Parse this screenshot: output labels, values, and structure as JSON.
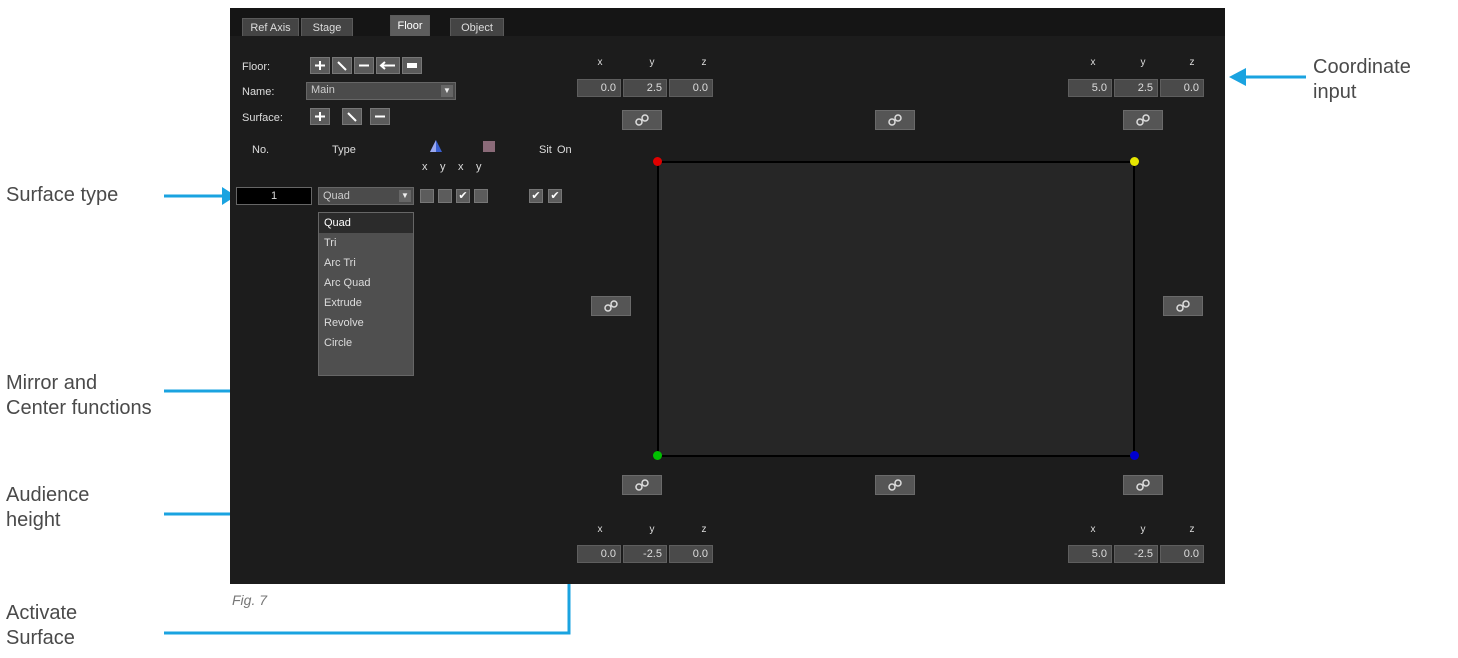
{
  "tabs": [
    "Ref Axis",
    "Stage",
    "Floor",
    "Object"
  ],
  "labels": {
    "floor": "Floor:",
    "name": "Name:",
    "surface": "Surface:"
  },
  "name_value": "Main",
  "headers": {
    "no": "No.",
    "type": "Type",
    "sit": "Sit",
    "on": "On",
    "x1": "x",
    "y1": "y",
    "x2": "x",
    "y2": "y"
  },
  "surface_row": {
    "number": "1",
    "type": "Quad",
    "checks": [
      false,
      false,
      true,
      false,
      true,
      true
    ]
  },
  "type_options": [
    "Quad",
    "Tri",
    "Arc Tri",
    "Arc Quad",
    "Extrude",
    "Revolve",
    "Circle"
  ],
  "coord_headers": [
    "x",
    "y",
    "z"
  ],
  "coords": {
    "top_left": [
      "0.0",
      "2.5",
      "0.0"
    ],
    "top_right": [
      "5.0",
      "2.5",
      "0.0"
    ],
    "bottom_left": [
      "0.0",
      "-2.5",
      "0.0"
    ],
    "bottom_right": [
      "5.0",
      "-2.5",
      "0.0"
    ]
  },
  "corner_colors": {
    "top_left": "#e00000",
    "top_right": "#e6e600",
    "bottom_left": "#00c000",
    "bottom_right": "#0000d0"
  },
  "callouts": {
    "surface_type": "Surface type",
    "mirror_center": [
      "Mirror and",
      "Center functions"
    ],
    "audience_height": [
      "Audience",
      "height"
    ],
    "activate_surface": [
      "Activate",
      "Surface"
    ],
    "coordinate_input": [
      "Coordinate",
      "input"
    ]
  },
  "caption": "Fig. 7",
  "accent_color": "#1aa3e0"
}
